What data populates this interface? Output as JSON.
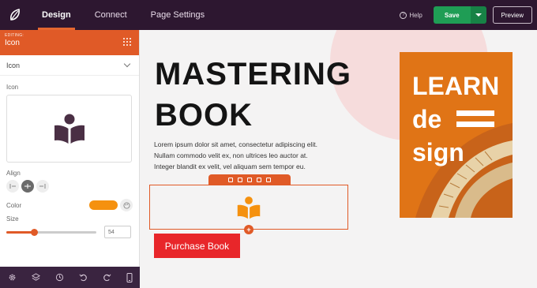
{
  "topbar": {
    "tabs": [
      {
        "label": "Design"
      },
      {
        "label": "Connect"
      },
      {
        "label": "Page Settings"
      }
    ],
    "help_label": "Help",
    "save_label": "Save",
    "preview_label": "Preview"
  },
  "sidebar": {
    "editing_label": "EDITING:",
    "editing_title": "Icon",
    "section_title": "Icon",
    "icon_label": "Icon",
    "align_label": "Align",
    "color_label": "Color",
    "color_value": "#f5910f",
    "size_label": "Size",
    "size_value": "54",
    "size_fraction": 0.31
  },
  "canvas": {
    "headline_line1": "MASTERING",
    "headline_line2": "BOOK",
    "body_line1": "Lorem ipsum dolor sit amet, consectetur adipiscing elit.",
    "body_line2": "Nullam commodo velit ex, non ultrices leo auctor at.",
    "body_line3": "Integer blandit ex velit, vel aliquam sem tempor eu.",
    "button_label": "Purchase Book",
    "book_word1": "LEARN",
    "book_word2": "de",
    "book_word3": "sign"
  },
  "colors": {
    "topbar": "#2d1730",
    "accent": "#e05a27",
    "save_green": "#1f9d55",
    "button_red": "#e8262a",
    "icon_orange": "#f5910f",
    "book_orange": "#e07416"
  },
  "icons": [
    "leaf-logo-icon",
    "drag-grid-icon",
    "chevron-down-icon",
    "book-reader-icon",
    "align-left-icon",
    "align-center-icon",
    "align-right-icon",
    "palette-icon",
    "gear-icon",
    "layers-icon",
    "history-icon",
    "undo-icon",
    "redo-icon",
    "mobile-icon",
    "help-icon",
    "move-icon",
    "copy-icon",
    "trash-icon",
    "add-icon"
  ]
}
